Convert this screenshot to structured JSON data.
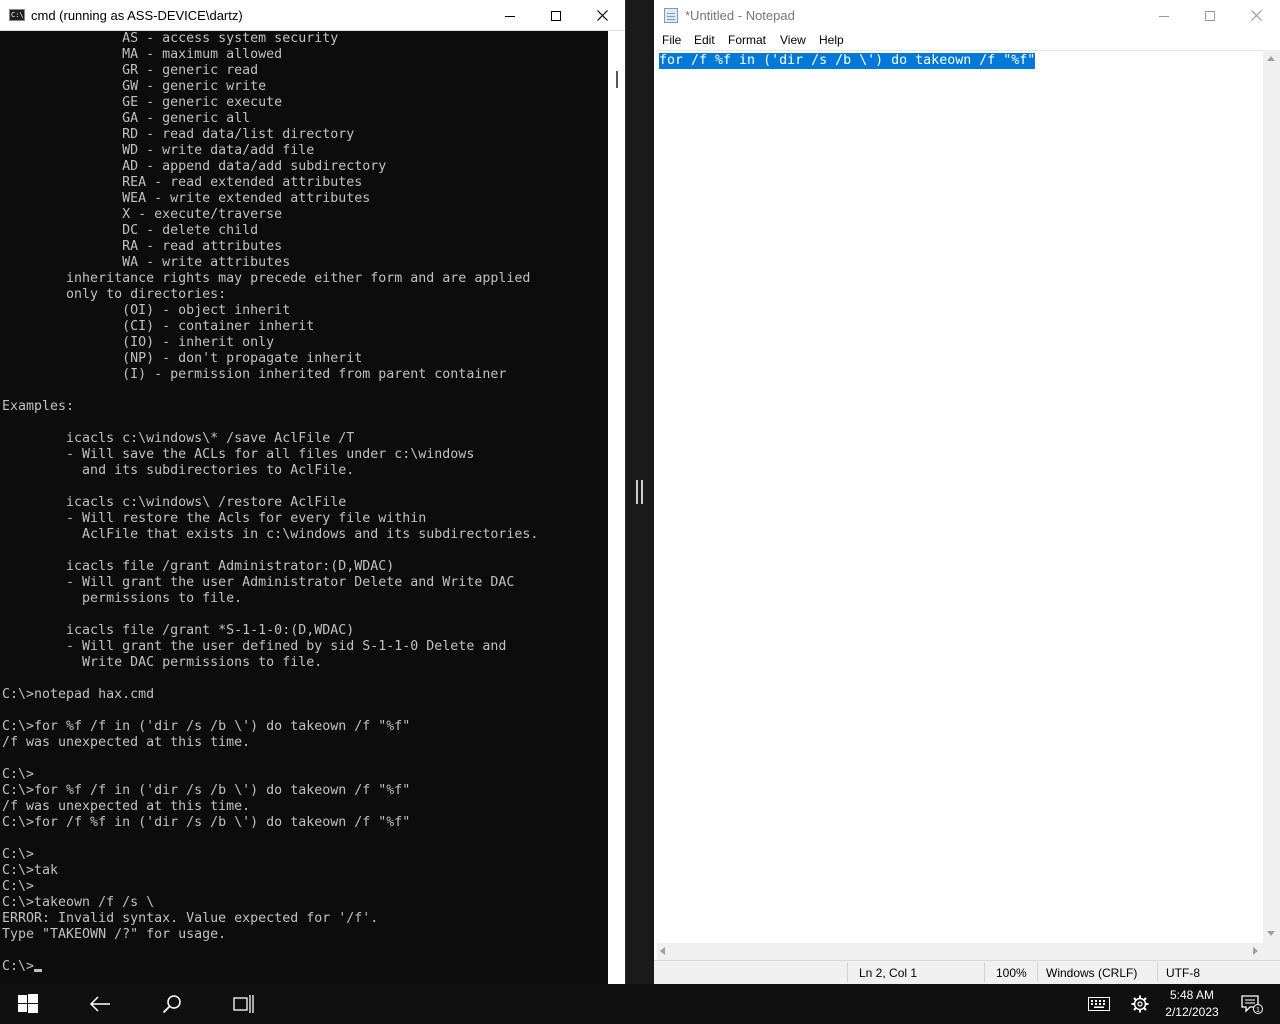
{
  "cmd": {
    "window_title": "cmd (running as ASS-DEVICE\\dartz)",
    "app_icon_text": "C:\\",
    "console_lines": [
      "               AS - access system security",
      "               MA - maximum allowed",
      "               GR - generic read",
      "               GW - generic write",
      "               GE - generic execute",
      "               GA - generic all",
      "               RD - read data/list directory",
      "               WD - write data/add file",
      "               AD - append data/add subdirectory",
      "               REA - read extended attributes",
      "               WEA - write extended attributes",
      "               X - execute/traverse",
      "               DC - delete child",
      "               RA - read attributes",
      "               WA - write attributes",
      "        inheritance rights may precede either form and are applied",
      "        only to directories:",
      "               (OI) - object inherit",
      "               (CI) - container inherit",
      "               (IO) - inherit only",
      "               (NP) - don't propagate inherit",
      "               (I) - permission inherited from parent container",
      "",
      "Examples:",
      "",
      "        icacls c:\\windows\\* /save AclFile /T",
      "        - Will save the ACLs for all files under c:\\windows",
      "          and its subdirectories to AclFile.",
      "",
      "        icacls c:\\windows\\ /restore AclFile",
      "        - Will restore the Acls for every file within",
      "          AclFile that exists in c:\\windows and its subdirectories.",
      "",
      "        icacls file /grant Administrator:(D,WDAC)",
      "        - Will grant the user Administrator Delete and Write DAC",
      "          permissions to file.",
      "",
      "        icacls file /grant *S-1-1-0:(D,WDAC)",
      "        - Will grant the user defined by sid S-1-1-0 Delete and",
      "          Write DAC permissions to file.",
      "",
      "C:\\>notepad hax.cmd",
      "",
      "C:\\>for %f /f in ('dir /s /b \\') do takeown /f \"%f\"",
      "/f was unexpected at this time.",
      "",
      "C:\\>",
      "C:\\>for %f /f in ('dir /s /b \\') do takeown /f \"%f\"",
      "/f was unexpected at this time.",
      "C:\\>for /f %f in ('dir /s /b \\') do takeown /f \"%f\"",
      "",
      "C:\\>",
      "C:\\>tak",
      "C:\\>",
      "C:\\>takeown /f /s \\",
      "ERROR: Invalid syntax. Value expected for '/f'.",
      "Type \"TAKEOWN /?\" for usage.",
      ""
    ],
    "prompt": "C:\\>"
  },
  "notepad": {
    "window_title": "*Untitled - Notepad",
    "menu": [
      "File",
      "Edit",
      "Format",
      "View",
      "Help"
    ],
    "content": "for /f %f in ('dir /s /b \\') do takeown /f \"%f\"",
    "status": {
      "position": "Ln 2, Col 1",
      "zoom": "100%",
      "line_ending": "Windows (CRLF)",
      "encoding": "UTF-8"
    }
  },
  "taskbar": {
    "time": "5:48 AM",
    "date": "2/12/2023",
    "notification_count": "1",
    "icons": [
      "windows-start-icon",
      "back-arrow-icon",
      "search-icon",
      "task-view-icon",
      "keyboard-icon",
      "gear-icon",
      "notification-icon"
    ]
  },
  "colors": {
    "console_bg": "#0c0c0c",
    "console_text": "#c0c0c0",
    "selection": "#0078d7",
    "taskbar_bg": "#101010"
  }
}
